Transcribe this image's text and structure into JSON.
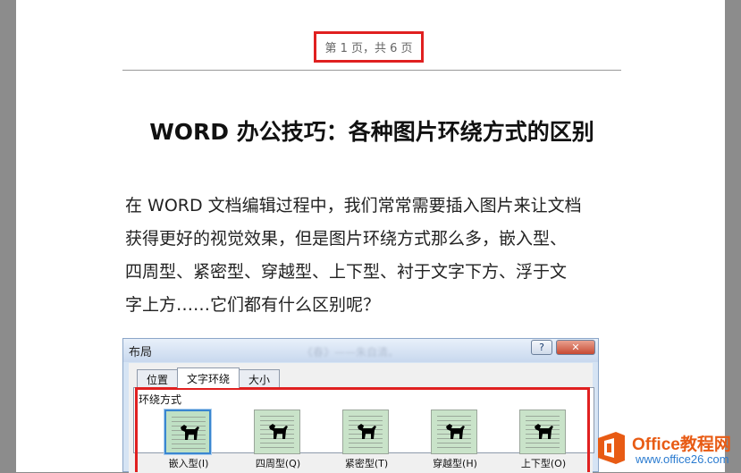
{
  "page_header": {
    "text": "第 1 页，共 6 页"
  },
  "document": {
    "title": "WORD 办公技巧：各种图片环绕方式的区别",
    "paragraph_lines": [
      "在 WORD 文档编辑过程中，我们常常需要插入图片来让文档",
      "获得更好的视觉效果，但是图片环绕方式那么多，嵌入型、",
      "四周型、紧密型、穿越型、上下型、衬于文字下方、浮于文",
      "字上方……它们都有什么区别呢？"
    ]
  },
  "dialog": {
    "title": "布局",
    "blurred_text": "《春》——朱自清。",
    "help_label": "?",
    "close_label": "✕",
    "tabs": [
      {
        "label": "位置",
        "active": false
      },
      {
        "label": "文字环绕",
        "active": true
      },
      {
        "label": "大小",
        "active": false
      }
    ],
    "section_label": "环绕方式",
    "wrap_options": [
      {
        "label": "嵌入型(I)",
        "selected": true
      },
      {
        "label": "四周型(Q)",
        "selected": false
      },
      {
        "label": "紧密型(T)",
        "selected": false
      },
      {
        "label": "穿越型(H)",
        "selected": false
      },
      {
        "label": "上下型(O)",
        "selected": false
      }
    ]
  },
  "watermark": {
    "line1": "Office教程网",
    "line2": "www.office26.com"
  },
  "colors": {
    "highlight": "#e02020",
    "icon_bg": "#c9e3c9",
    "watermark_orange": "#e85b14",
    "watermark_blue": "#2a7bd0"
  }
}
